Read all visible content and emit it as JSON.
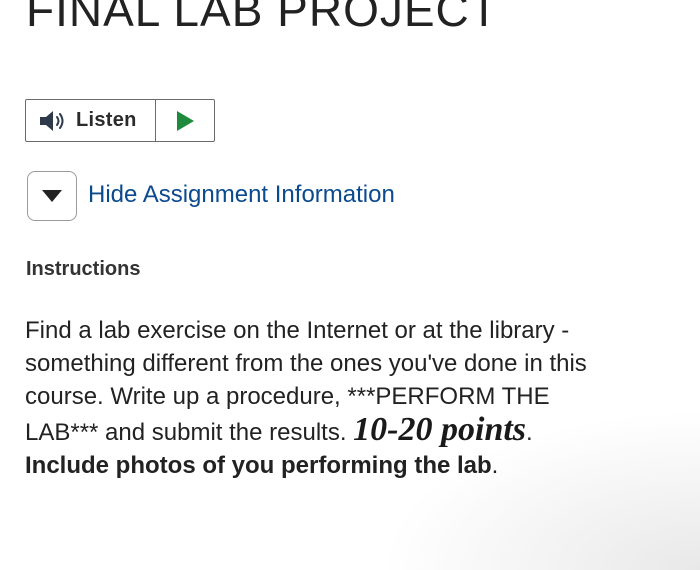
{
  "page": {
    "title": "FINAL LAB PROJECT"
  },
  "listen": {
    "label": "Listen",
    "speaker_icon": "speaker-icon",
    "play_icon": "play-icon",
    "play_color": "#1e8a3c"
  },
  "assignment_toggle": {
    "label": "Hide Assignment Information",
    "icon": "caret-down-icon",
    "link_color": "#0b4a8e"
  },
  "instructions": {
    "heading": "Instructions",
    "line1": "Find a lab exercise on the Internet or at the library -",
    "line2": "something different from the ones you've done in this",
    "line3": "course. Write up a procedure, ***PERFORM THE",
    "line4a": "LAB*** and submit the results. ",
    "line4_points": "10-20 points",
    "line4_end": ".",
    "line5": "Include photos of you performing the lab",
    "line5_end": "."
  }
}
